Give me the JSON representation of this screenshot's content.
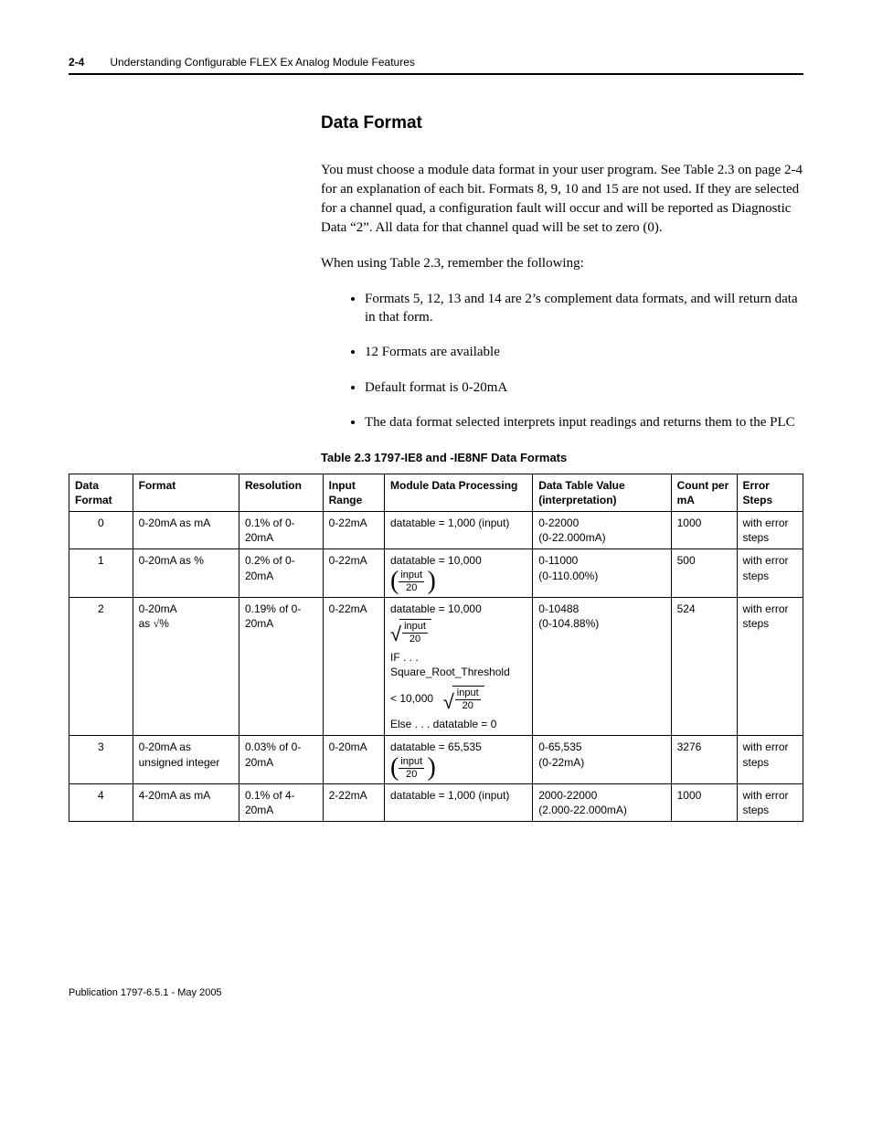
{
  "header": {
    "page_num": "2-4",
    "title": "Understanding Configurable FLEX Ex Analog Module Features"
  },
  "section": {
    "heading": "Data Format",
    "para1": "You must choose a module data format in your user program. See Table 2.3 on page 2-4 for an explanation of each bit. Formats 8, 9, 10 and 15 are not used. If they are selected for a channel quad, a configuration fault will occur and will be reported as Diagnostic Data “2”. All data for that channel quad will be set to zero (0).",
    "para2": "When using Table 2.3, remember the following:",
    "bullets": [
      "Formats 5, 12, 13 and 14 are 2’s complement data formats, and will return data in that form.",
      "12 Formats are available",
      "Default format is 0-20mA",
      "The data format selected interprets input readings and returns them to the PLC"
    ]
  },
  "table": {
    "caption": "Table 2.3 1797-IE8 and -IE8NF Data Formats",
    "headers": [
      "Data Format",
      "Format",
      "Resolution",
      "Input Range",
      "Module Data Processing",
      "Data Table Value (interpretation)",
      "Count per mA",
      "Error Steps"
    ],
    "rows": [
      {
        "df": "0",
        "format": "0-20mA as mA",
        "resolution": "0.1% of 0-20mA",
        "range": "0-22mA",
        "processing_text": "datatable = 1,000 (input)",
        "dtv": [
          "0-22000",
          "(0-22.000mA)"
        ],
        "count": "1000",
        "error": "with error steps"
      },
      {
        "df": "1",
        "format": "0-20mA as %",
        "resolution": "0.2% of 0-20mA",
        "range": "0-22mA",
        "processing_formula": {
          "prefix": "datatable = 10,000",
          "frac_num": "input",
          "frac_den": "20",
          "type": "paren"
        },
        "dtv": [
          "0-11000",
          "(0-110.00%)"
        ],
        "count": "500",
        "error": "with error steps"
      },
      {
        "df": "2",
        "format_special": "0-20mA as √%",
        "resolution": "0.19% of 0-20mA",
        "range": "0-22mA",
        "processing_multi": {
          "line1": {
            "prefix": "datatable = 10,000",
            "frac_num": "input",
            "frac_den": "20"
          },
          "line2": "IF . . . Square_Root_Threshold",
          "line3": {
            "prefix": "< 10,000",
            "frac_num": "input",
            "frac_den": "20"
          },
          "line4": "Else . . . datatable = 0"
        },
        "dtv": [
          "0-10488",
          "(0-104.88%)"
        ],
        "count": "524",
        "error": "with error steps"
      },
      {
        "df": "3",
        "format": "0-20mA as unsigned integer",
        "resolution": "0.03% of 0-20mA",
        "range": "0-20mA",
        "processing_formula": {
          "prefix": "datatable = 65,535",
          "frac_num": "input",
          "frac_den": "20",
          "type": "paren"
        },
        "dtv": [
          "0-65,535",
          "(0-22mA)"
        ],
        "count": "3276",
        "error": "with error steps"
      },
      {
        "df": "4",
        "format": "4-20mA as mA",
        "resolution": "0.1% of 4-20mA",
        "range": "2-22mA",
        "processing_text": "datatable = 1,000 (input)",
        "dtv": [
          "2000-22000",
          "(2.000-22.000mA)"
        ],
        "count": "1000",
        "error": "with error steps"
      }
    ]
  },
  "footer": "Publication 1797-6.5.1 - May 2005"
}
